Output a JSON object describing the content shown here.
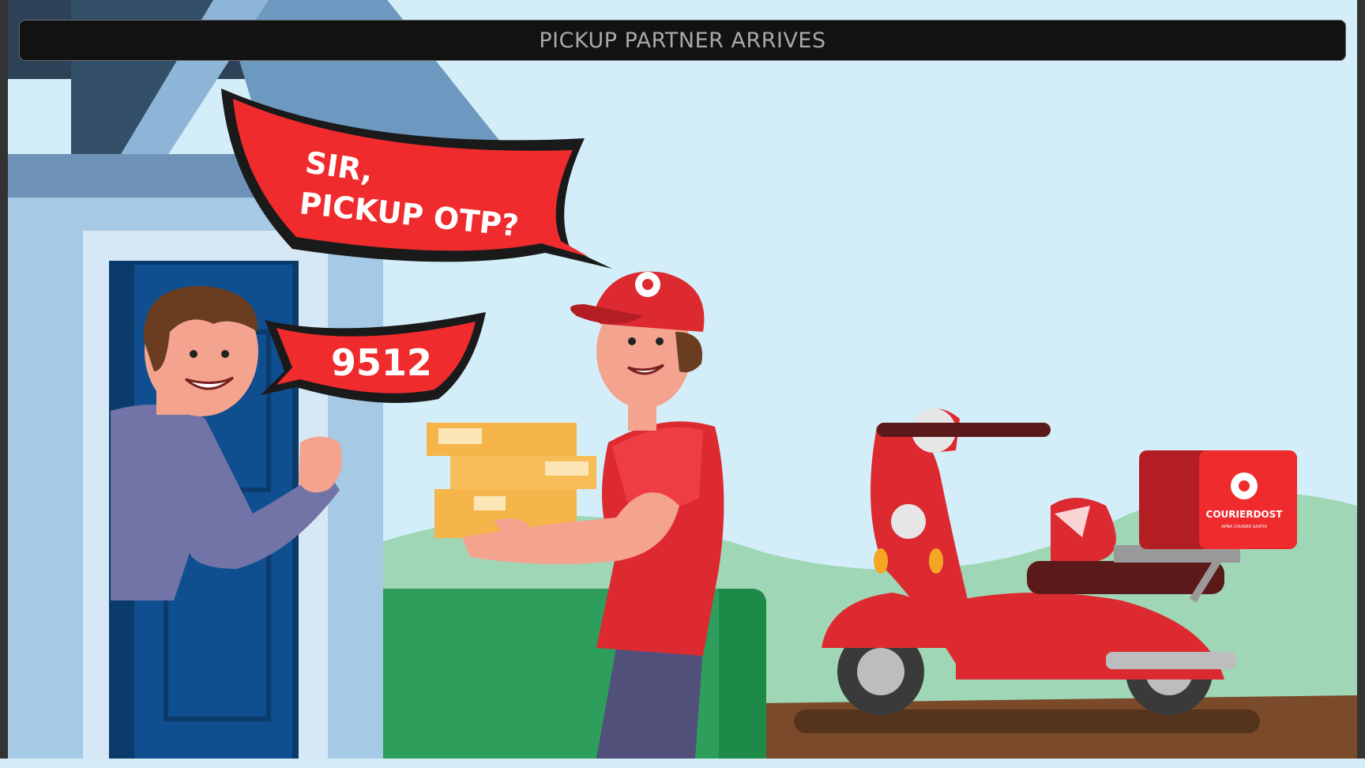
{
  "header": {
    "title": "PICKUP PARTNER ARRIVES"
  },
  "speech": {
    "partner_line1": "SIR,",
    "partner_line2": "PICKUP OTP?",
    "customer_reply": "9512"
  },
  "brand": {
    "name": "COURIERDOST",
    "tagline": "APNA COURIER SAATHI"
  },
  "colors": {
    "sky": "#d3eef9",
    "accent_red": "#ef2b2d",
    "door_blue": "#0d4a8a",
    "ground": "#7a4a2a"
  }
}
